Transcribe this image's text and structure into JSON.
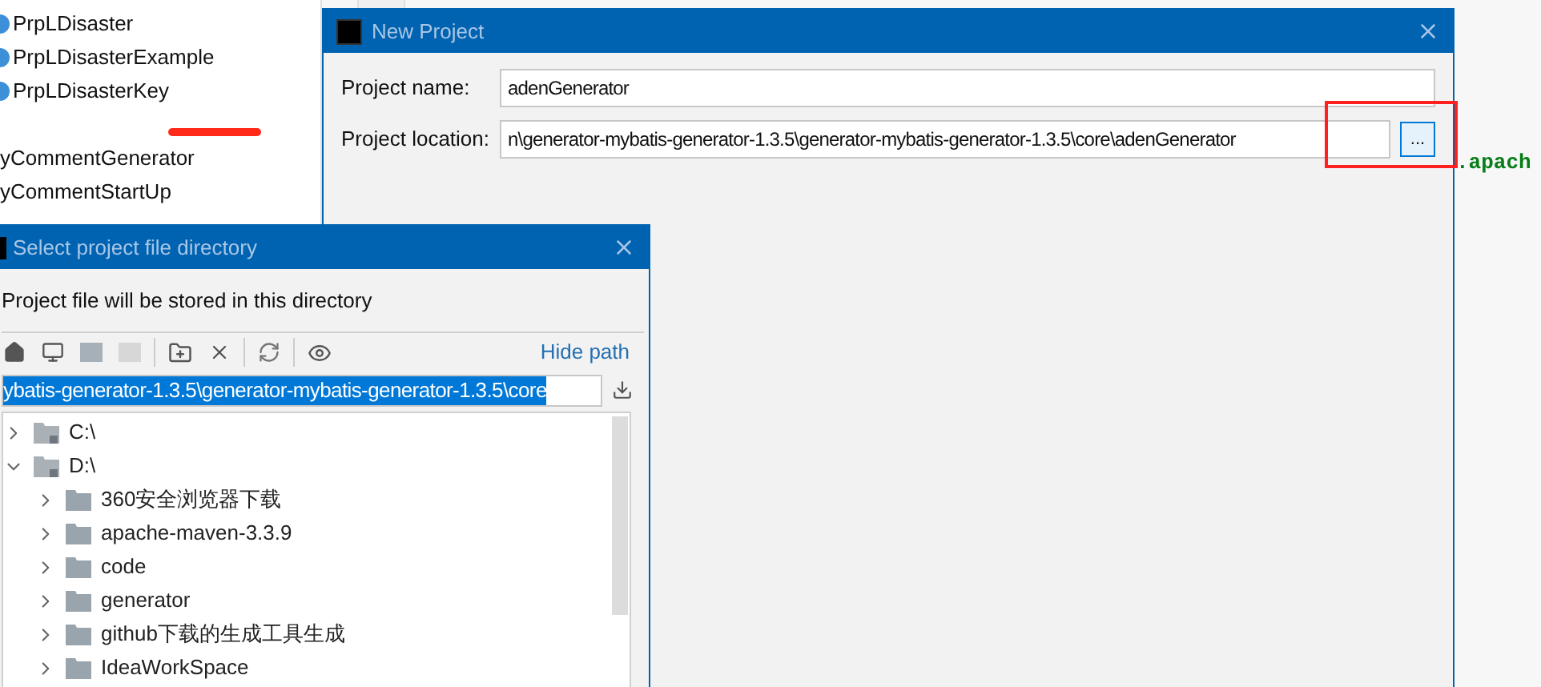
{
  "project_tree": {
    "items": [
      {
        "label": "PrpLDisaster",
        "kind": "class"
      },
      {
        "label": "PrpLDisasterExample",
        "kind": "class"
      },
      {
        "label": "PrpLDisasterKey",
        "kind": "class"
      },
      {
        "label": "yCommentGenerator",
        "kind": "plain"
      },
      {
        "label": "yCommentStartUp",
        "kind": "plain"
      }
    ]
  },
  "editor": {
    "fragment": ".apach"
  },
  "new_project": {
    "title": "New Project",
    "fields": [
      {
        "label": "Project name:",
        "value": "adenGenerator",
        "browse": false
      },
      {
        "label": "Project location:",
        "value": "n\\generator-mybatis-generator-1.3.5\\generator-mybatis-generator-1.3.5\\core\\adenGenerator",
        "browse": true
      }
    ],
    "browse_label": "..."
  },
  "file_dialog": {
    "title": "Select project file directory",
    "description": "Project file will be stored in this directory",
    "hide_path": "Hide path",
    "path": "ybatis-generator-1.3.5\\generator-mybatis-generator-1.3.5\\core",
    "path_selected": true,
    "tree": [
      {
        "label": "C:\\",
        "kind": "drive",
        "expanded": false
      },
      {
        "label": "D:\\",
        "kind": "drive",
        "expanded": true,
        "children": [
          {
            "label": "360安全浏览器下载",
            "kind": "folder",
            "expanded": false
          },
          {
            "label": "apache-maven-3.3.9",
            "kind": "folder",
            "expanded": false
          },
          {
            "label": "code",
            "kind": "folder",
            "expanded": false
          },
          {
            "label": "generator",
            "kind": "folder",
            "expanded": false
          },
          {
            "label": "github下载的生成工具生成",
            "kind": "folder",
            "expanded": false
          },
          {
            "label": "IdeaWorkSpace",
            "kind": "folder",
            "expanded": false
          }
        ]
      }
    ]
  }
}
